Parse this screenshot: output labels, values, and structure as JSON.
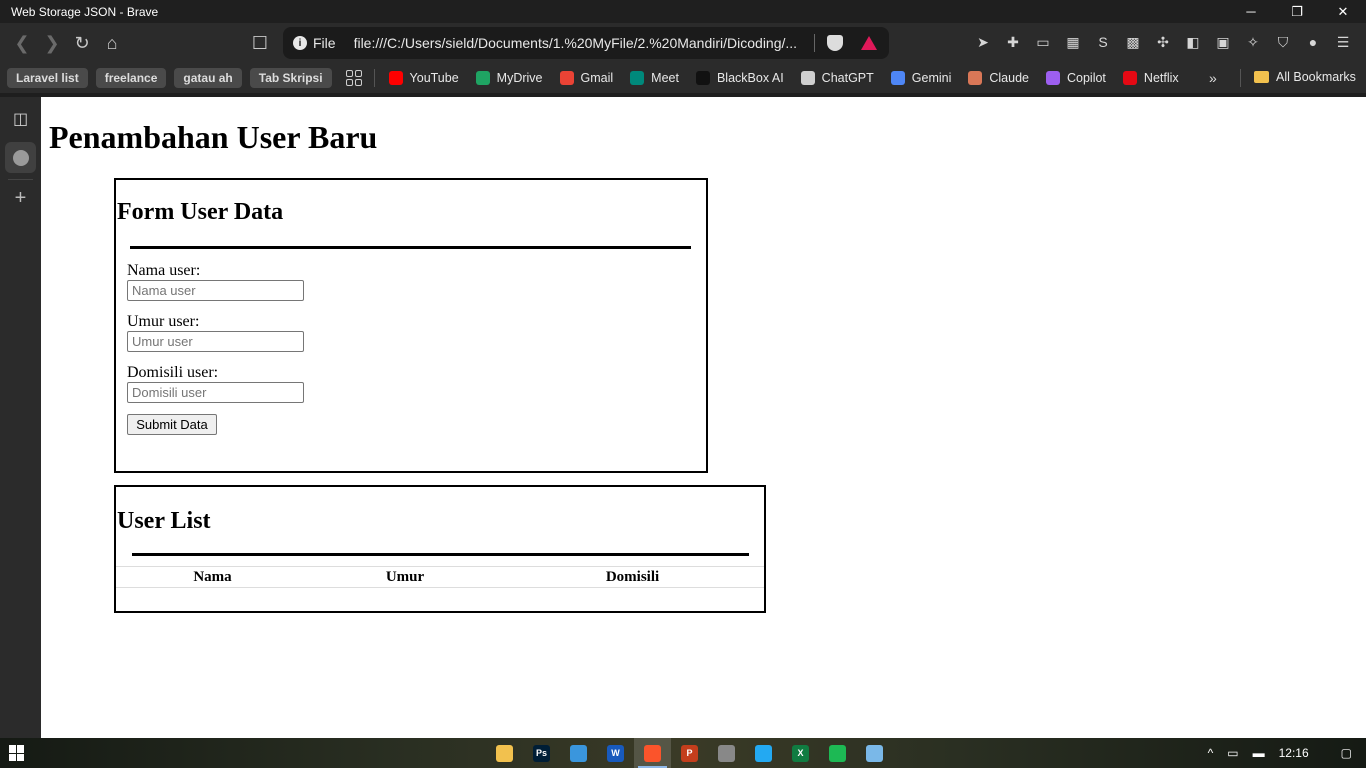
{
  "window": {
    "title": "Web Storage JSON - Brave",
    "minimize_glyph": "─",
    "restore_glyph": "❐",
    "close_glyph": "✕"
  },
  "navbar": {
    "back_glyph": "❮",
    "forward_glyph": "❯",
    "reload_glyph": "↻",
    "home_glyph": "⌂",
    "bookmark_glyph": "☐",
    "url_scheme": "File",
    "url": "file:///C:/Users/sield/Documents/1.%20MyFile/2.%20Mandiri/Dicoding/...",
    "extensions": [
      {
        "name": "ext-arrow-icon",
        "glyph": "➤"
      },
      {
        "name": "ext-wrench-icon",
        "glyph": "✚"
      },
      {
        "name": "ext-file-icon",
        "glyph": "▭"
      },
      {
        "name": "ext-qr-icon",
        "glyph": "▦"
      },
      {
        "name": "ext-s-icon",
        "glyph": "S"
      },
      {
        "name": "ext-pattern-icon",
        "glyph": "▩"
      },
      {
        "name": "extensions-puzzle-icon",
        "glyph": "✣"
      },
      {
        "name": "sidebar-toggle-icon",
        "glyph": "◧"
      },
      {
        "name": "wallet-icon",
        "glyph": "▣"
      },
      {
        "name": "leo-ai-icon",
        "glyph": "✧"
      },
      {
        "name": "vpn-shield-icon",
        "glyph": "⛉"
      },
      {
        "name": "profile-avatar-icon",
        "glyph": "●"
      },
      {
        "name": "menu-icon",
        "glyph": "☰"
      }
    ]
  },
  "bookmarks": {
    "chips": [
      "Laravel list",
      "freelance",
      "gatau ah",
      "Tab Skripsi"
    ],
    "links": [
      {
        "label": "YouTube",
        "color": "#ff0000"
      },
      {
        "label": "MyDrive",
        "color": "#1fa463"
      },
      {
        "label": "Gmail",
        "color": "#ea4335"
      },
      {
        "label": "Meet",
        "color": "#00897b"
      },
      {
        "label": "BlackBox AI",
        "color": "#111111"
      },
      {
        "label": "ChatGPT",
        "color": "#cfcfcf"
      },
      {
        "label": "Gemini",
        "color": "#4e86f5"
      },
      {
        "label": "Claude",
        "color": "#d97757"
      },
      {
        "label": "Copilot",
        "color": "#9d5ff0"
      },
      {
        "label": "Netflix",
        "color": "#e50914"
      }
    ],
    "more_glyph": "»",
    "all_bookmarks": "All Bookmarks"
  },
  "sidebar": {
    "panel_glyph": "◫",
    "add_glyph": "+"
  },
  "page": {
    "heading": "Penambahan User Baru",
    "form": {
      "title": "Form User Data",
      "fields": [
        {
          "label": "Nama user:",
          "placeholder": "Nama user",
          "value": ""
        },
        {
          "label": "Umur user:",
          "placeholder": "Umur user",
          "value": ""
        },
        {
          "label": "Domisili user:",
          "placeholder": "Domisili user",
          "value": ""
        }
      ],
      "submit_label": "Submit Data"
    },
    "list": {
      "title": "User List",
      "columns": [
        "Nama",
        "Umur",
        "Domisili"
      ],
      "rows": []
    }
  },
  "taskbar": {
    "apps": [
      {
        "name": "file-explorer-icon",
        "label": "",
        "color": "#f2c14e",
        "active": false
      },
      {
        "name": "photoshop-icon",
        "label": "Ps",
        "color": "#001e36",
        "active": false
      },
      {
        "name": "store-icon",
        "label": "",
        "color": "#3a96dd",
        "active": false
      },
      {
        "name": "word-icon",
        "label": "W",
        "color": "#185abd",
        "active": false
      },
      {
        "name": "brave-icon",
        "label": "",
        "color": "#fb542b",
        "active": true
      },
      {
        "name": "powerpoint-icon",
        "label": "P",
        "color": "#c43e1c",
        "active": false
      },
      {
        "name": "paint-icon",
        "label": "",
        "color": "#888888",
        "active": false
      },
      {
        "name": "vscode-icon",
        "label": "",
        "color": "#23a9f2",
        "active": false
      },
      {
        "name": "excel-icon",
        "label": "X",
        "color": "#107c41",
        "active": false
      },
      {
        "name": "spotify-icon",
        "label": "",
        "color": "#1db954",
        "active": false
      },
      {
        "name": "notepad-icon",
        "label": "",
        "color": "#7ab8e8",
        "active": false
      }
    ],
    "tray": {
      "chevron_glyph": "^",
      "network_glyph": "▭",
      "battery_glyph": "▬",
      "time": "12:16",
      "notification_glyph": "▢"
    }
  }
}
